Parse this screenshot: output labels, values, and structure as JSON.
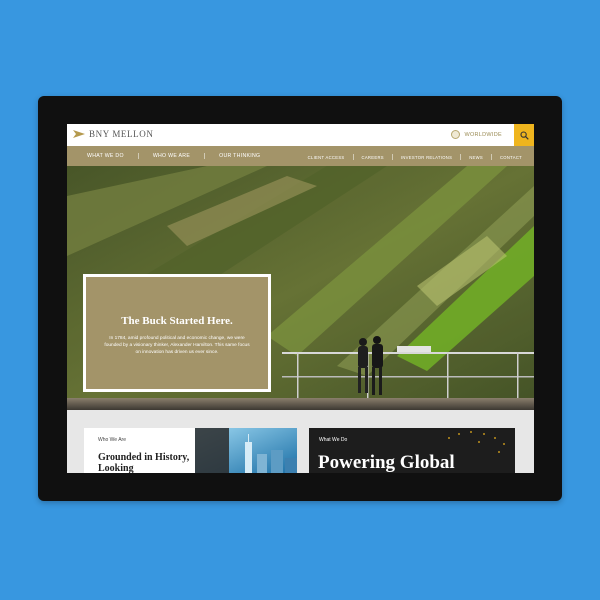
{
  "brand": {
    "name": "BNY MELLON"
  },
  "header": {
    "region_label": "WORLDWIDE",
    "search_icon": "search-icon",
    "accent_color": "#efb51e",
    "gold_color": "#a39469"
  },
  "nav": {
    "primary": [
      "WHAT WE DO",
      "WHO WE ARE",
      "OUR THINKING"
    ],
    "secondary": [
      "CLIENT ACCESS",
      "CAREERS",
      "INVESTOR RELATIONS",
      "NEWS",
      "CONTACT"
    ]
  },
  "hero": {
    "title": "The Buck Started Here.",
    "text": "In 1784, amid profound political and economic change, we were founded by a visionary thinker, Alexander Hamilton. This same focus on innovation has driven us ever since."
  },
  "cards": {
    "who": {
      "label": "Who We Are",
      "heading": "Grounded in History, Looking"
    },
    "what": {
      "label": "What We Do",
      "heading": "Powering Global"
    }
  }
}
